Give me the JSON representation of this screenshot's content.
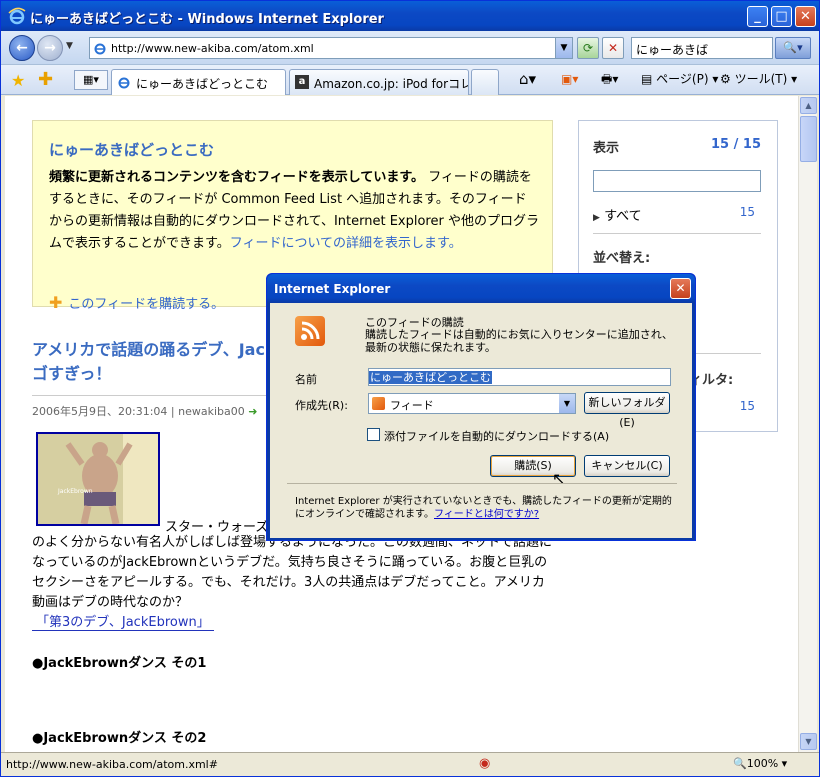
{
  "window": {
    "title": "にゅーあきばどっとこむ - Windows Internet Explorer",
    "minimize": "_",
    "maximize": "□",
    "close": "✕"
  },
  "navbar": {
    "back": "←",
    "forward": "→",
    "address": "http://www.new-akiba.com/atom.xml",
    "search_value": "にゅーあきば"
  },
  "tabs": [
    {
      "label": "にゅーあきばどっとこむ",
      "close": "✕"
    },
    {
      "label": "Amazon.co.jp: iPod forコレク..."
    }
  ],
  "toolbar": {
    "page": "ページ(P)",
    "tools": "ツール(T)"
  },
  "feed": {
    "title": "にゅーあきばどっとこむ",
    "desc_bold": "頻繁に更新されるコンテンツを含むフィードを表示しています。",
    "desc_text": " フィードの購読をするときに、そのフィードが Common Feed List へ追加されます。そのフィードからの更新情報は自動的にダウンロードされて、Internet Explorer や他のプログラムで表示することができます。",
    "desc_link": "フィードについての詳細を表示します。",
    "subscribe": "このフィードを購読する。"
  },
  "sidebar": {
    "display_label": "表示",
    "display_count": "15 / 15",
    "all_label": "すべて",
    "all_count": "15",
    "sort_label": "並べ替え:",
    "filter_label": "ィルタ:",
    "filter_count": "15"
  },
  "article": {
    "title": "アメリカで話題の踊るデブ、JackEbrownの激しく痛々しいダンスがスゴすぎっ！",
    "meta": "2006年5月9日、20:31:04 | newakiba00",
    "img_caption": "JackEbrown",
    "body_line1": "スター・ウォーズ",
    "body_rest": "のよく分からない有名人がしばしば登場するようになった。この数週間、ネットで話題になっているのがJackEbrownというデブだ。気持ち良さそうに踊っている。お腹と巨乳のセクシーさをアピールする。でも、それだけ。3人の共通点はデブだってこと。アメリカ動画はデブの時代なのか？",
    "link": "「第3のデブ、JackEbrown」",
    "dance1": "●JackEbrownダンス その1",
    "dance2": "●JackEbrownダンス その2"
  },
  "status": {
    "url": "http://www.new-akiba.com/atom.xml#",
    "zoom": "100%"
  },
  "dialog": {
    "title": "Internet Explorer",
    "heading": "このフィードの購読",
    "desc": "購読したフィードは自動的にお気に入りセンターに追加され、最新の状態に保たれます。",
    "name_label": "名前",
    "name_value": "にゅーあきばどっとこむ",
    "dest_label": "作成先(R):",
    "dest_value": "フィード",
    "new_folder": "新しいフォルダ(E)",
    "checkbox_label": "添付ファイルを自動的にダウンロードする(A)",
    "subscribe_btn": "購読(S)",
    "cancel_btn": "キャンセル(C)",
    "footer": "Internet Explorer が実行されていないときでも、購読したフィードの更新が定期的にオンラインで確認されます。",
    "footer_link": "フィードとは何ですか?"
  },
  "colors": {
    "link": "#3366cc",
    "feed_bg": "#ffffcc",
    "title_blue": "#3a6bc1"
  }
}
